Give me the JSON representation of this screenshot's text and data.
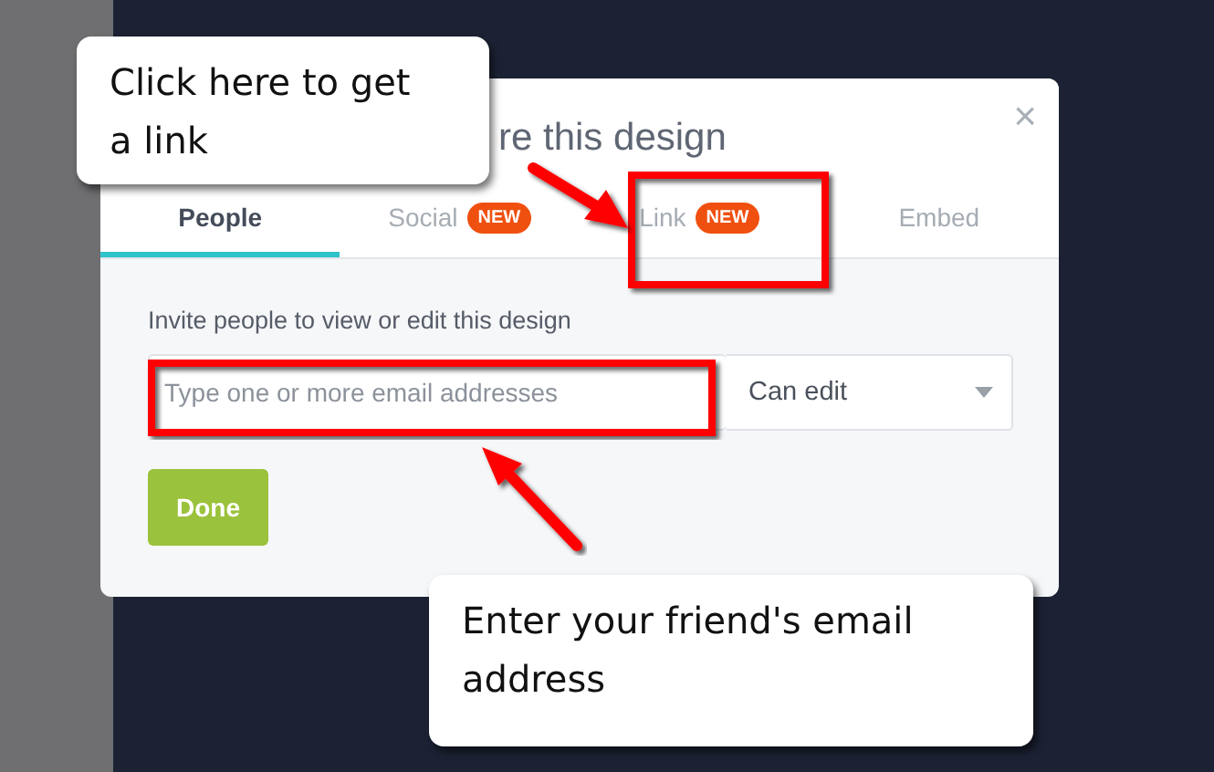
{
  "dialog": {
    "title": "re this design",
    "close": "×",
    "tabs": [
      {
        "label": "People",
        "selected": true
      },
      {
        "label": "Social",
        "badge": "NEW",
        "selected": false
      },
      {
        "label": "Link",
        "badge": "NEW",
        "selected": false
      },
      {
        "label": "Embed",
        "selected": false
      }
    ],
    "invite_label": "Invite people to view or edit this design",
    "email_field": {
      "placeholder": "Type one or more email addresses"
    },
    "permission": {
      "value": "Can edit"
    },
    "done_button": "Done"
  },
  "callouts": [
    {
      "text": "Click here to get a link"
    },
    {
      "text": "Enter your friend's email address"
    }
  ]
}
